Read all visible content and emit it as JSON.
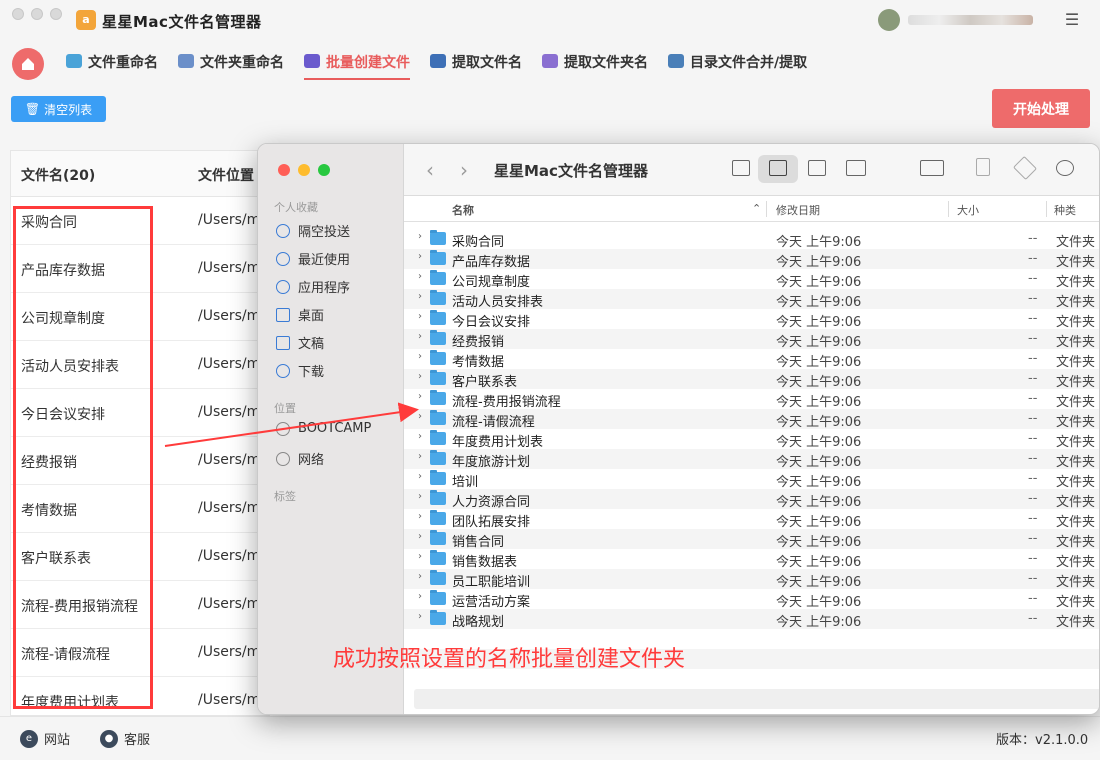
{
  "app": {
    "title": "星星Mac文件名管理器",
    "logo_text": "a"
  },
  "tabs": [
    {
      "label": "文件重命名",
      "icon": "rename-icon",
      "color": "#4aa3d8"
    },
    {
      "label": "文件夹重命名",
      "icon": "folder-rename-icon",
      "color": "#6b8fc9"
    },
    {
      "label": "批量创建文件",
      "icon": "batch-create-icon",
      "color": "#6a5acd",
      "active": true
    },
    {
      "label": "提取文件名",
      "icon": "extract-file-icon",
      "color": "#3d6fb6"
    },
    {
      "label": "提取文件夹名",
      "icon": "extract-folder-icon",
      "color": "#8a6fd1"
    },
    {
      "label": "目录文件合并/提取",
      "icon": "merge-icon",
      "color": "#4a7fb8"
    }
  ],
  "toolbar": {
    "clear_label": "清空列表",
    "start_label": "开始处理"
  },
  "table": {
    "headers": [
      "文件名(20)",
      "文件位置"
    ],
    "rows": [
      {
        "name": "采购合同",
        "path": "/Users/ma"
      },
      {
        "name": "产品库存数据",
        "path": "/Users/ma"
      },
      {
        "name": "公司规章制度",
        "path": "/Users/ma"
      },
      {
        "name": "活动人员安排表",
        "path": "/Users/ma"
      },
      {
        "name": "今日会议安排",
        "path": "/Users/ma"
      },
      {
        "name": "经费报销",
        "path": "/Users/ma"
      },
      {
        "name": "考情数据",
        "path": "/Users/ma"
      },
      {
        "name": "客户联系表",
        "path": "/Users/ma"
      },
      {
        "name": "流程-费用报销流程",
        "path": "/Users/ma"
      },
      {
        "name": "流程-请假流程",
        "path": "/Users/ma"
      },
      {
        "name": "年度费用计划表",
        "path": "/Users/ma"
      }
    ]
  },
  "statusbar": {
    "website_label": "网站",
    "support_label": "客服",
    "version": "版本：v2.1.0.0"
  },
  "finder": {
    "title": "星星Mac文件名管理器",
    "sidebar": {
      "favorites_label": "个人收藏",
      "favorites": [
        {
          "label": "隔空投送",
          "icon": "airdrop-icon"
        },
        {
          "label": "最近使用",
          "icon": "clock-icon"
        },
        {
          "label": "应用程序",
          "icon": "apps-icon"
        },
        {
          "label": "桌面",
          "icon": "desktop-icon"
        },
        {
          "label": "文稿",
          "icon": "document-icon"
        },
        {
          "label": "下载",
          "icon": "download-icon"
        }
      ],
      "locations_label": "位置",
      "locations": [
        {
          "label": "BOOTCAMP",
          "icon": "disk-icon"
        },
        {
          "label": "网络",
          "icon": "network-icon"
        }
      ],
      "tags_label": "标签"
    },
    "columns": [
      "名称",
      "修改日期",
      "大小",
      "种类"
    ],
    "items": [
      {
        "name": "采购合同",
        "date": "今天 上午9:06",
        "size": "--",
        "kind": "文件夹"
      },
      {
        "name": "产品库存数据",
        "date": "今天 上午9:06",
        "size": "--",
        "kind": "文件夹"
      },
      {
        "name": "公司规章制度",
        "date": "今天 上午9:06",
        "size": "--",
        "kind": "文件夹"
      },
      {
        "name": "活动人员安排表",
        "date": "今天 上午9:06",
        "size": "--",
        "kind": "文件夹"
      },
      {
        "name": "今日会议安排",
        "date": "今天 上午9:06",
        "size": "--",
        "kind": "文件夹"
      },
      {
        "name": "经费报销",
        "date": "今天 上午9:06",
        "size": "--",
        "kind": "文件夹"
      },
      {
        "name": "考情数据",
        "date": "今天 上午9:06",
        "size": "--",
        "kind": "文件夹"
      },
      {
        "name": "客户联系表",
        "date": "今天 上午9:06",
        "size": "--",
        "kind": "文件夹"
      },
      {
        "name": "流程-费用报销流程",
        "date": "今天 上午9:06",
        "size": "--",
        "kind": "文件夹"
      },
      {
        "name": "流程-请假流程",
        "date": "今天 上午9:06",
        "size": "--",
        "kind": "文件夹"
      },
      {
        "name": "年度费用计划表",
        "date": "今天 上午9:06",
        "size": "--",
        "kind": "文件夹"
      },
      {
        "name": "年度旅游计划",
        "date": "今天 上午9:06",
        "size": "--",
        "kind": "文件夹"
      },
      {
        "name": "培训",
        "date": "今天 上午9:06",
        "size": "--",
        "kind": "文件夹"
      },
      {
        "name": "人力资源合同",
        "date": "今天 上午9:06",
        "size": "--",
        "kind": "文件夹"
      },
      {
        "name": "团队拓展安排",
        "date": "今天 上午9:06",
        "size": "--",
        "kind": "文件夹"
      },
      {
        "name": "销售合同",
        "date": "今天 上午9:06",
        "size": "--",
        "kind": "文件夹"
      },
      {
        "name": "销售数据表",
        "date": "今天 上午9:06",
        "size": "--",
        "kind": "文件夹"
      },
      {
        "name": "员工职能培训",
        "date": "今天 上午9:06",
        "size": "--",
        "kind": "文件夹"
      },
      {
        "name": "运营活动方案",
        "date": "今天 上午9:06",
        "size": "--",
        "kind": "文件夹"
      },
      {
        "name": "战略规划",
        "date": "今天 上午9:06",
        "size": "--",
        "kind": "文件夹"
      }
    ]
  },
  "annotation": "成功按照设置的名称批量创建文件夹",
  "colors": {
    "accent_red": "#ee6b6b",
    "accent_blue": "#3a9ef5",
    "annotation_red": "#ff3b3b",
    "folder_blue": "#4aa8e8"
  }
}
